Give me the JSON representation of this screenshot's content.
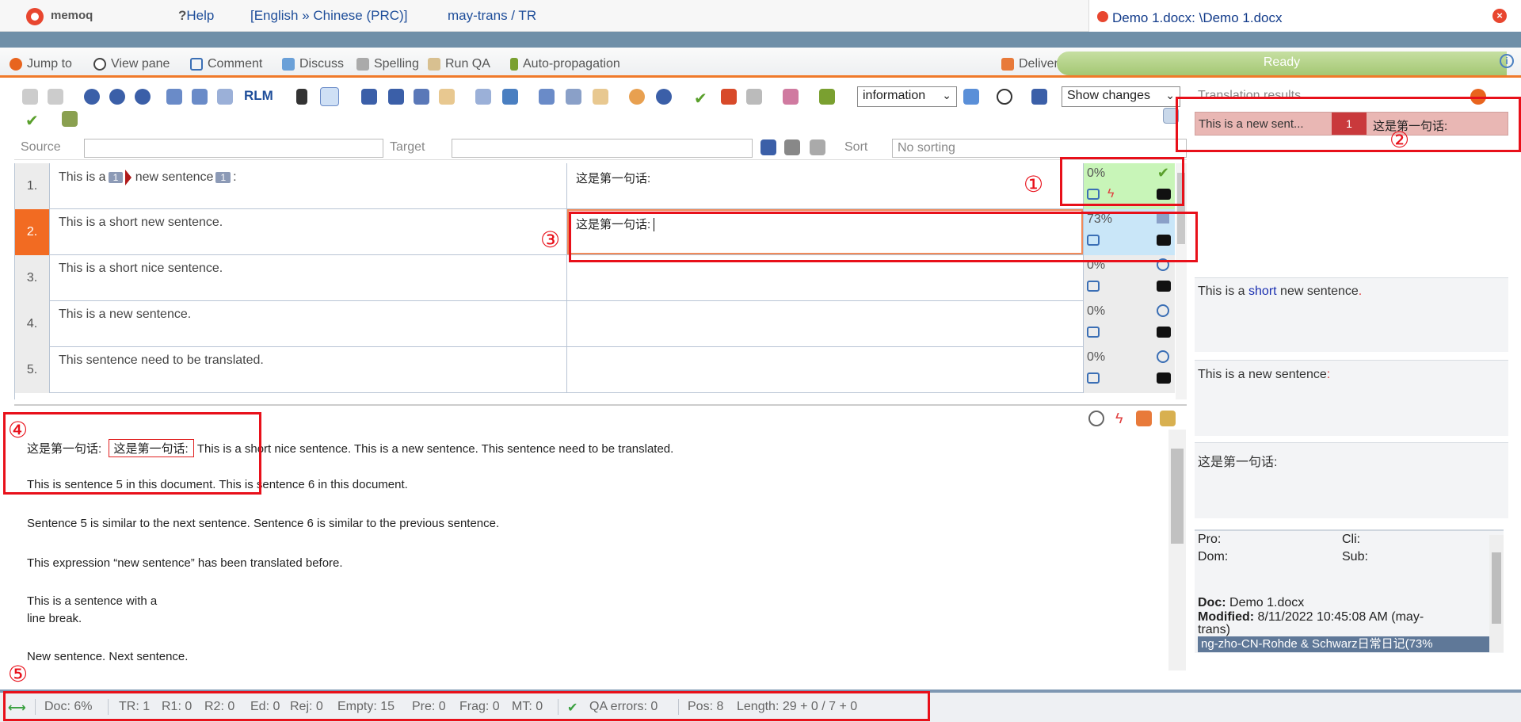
{
  "topbar": {
    "logo": "memoq",
    "help": "Help",
    "language": "[English » Chinese (PRC)]",
    "project": "may-trans / TR",
    "document_tab": "Demo 1.docx: \\Demo 1.docx"
  },
  "ribbon": {
    "items": [
      "Jump to",
      "View pane",
      "Comment",
      "Discuss",
      "Spelling",
      "Run QA",
      "Auto-propagation"
    ],
    "deliver": "Deliver",
    "status": "Ready"
  },
  "toolbar": {
    "rlm": "RLM",
    "information_select": "information",
    "show_changes_select": "Show changes"
  },
  "filter": {
    "source_label": "Source",
    "target_label": "Target",
    "sort_label": "Sort",
    "sort_value": "No sorting"
  },
  "grid": {
    "rows": [
      {
        "num": "1.",
        "source_a": "This is a",
        "source_b": "new sentence",
        "source_c": ":",
        "tag1": "1",
        "tag2": "1",
        "target": "这是第一句话:",
        "percent": "0%"
      },
      {
        "num": "2.",
        "source": "This is a short new sentence.",
        "target": "这是第一句话:",
        "percent": "73%"
      },
      {
        "num": "3.",
        "source": "This is a short nice sentence.",
        "target": "",
        "percent": "0%"
      },
      {
        "num": "4.",
        "source": "This is a new sentence.",
        "target": "",
        "percent": "0%"
      },
      {
        "num": "5.",
        "source": "This sentence need to be translated.",
        "target": "",
        "percent": "0%"
      }
    ]
  },
  "preview": {
    "line1_a": "这是第一句话:",
    "line1_b": "这是第一句话:",
    "line1_c": "This is a short nice sentence. This is a new sentence. This sentence need to be translated.",
    "line2": "This is sentence 5 in this document. This is sentence 6 in this document.",
    "line3": "Sentence 5 is similar to the next sentence. Sentence 6 is similar to the previous sentence.",
    "line4": "This expression “new sentence” has been translated before.",
    "line5a": "This is a sentence with a",
    "line5b": "line break.",
    "line6": "New sentence. Next sentence."
  },
  "translation_results": {
    "title": "Translation results",
    "hit_source": "This is a new sent...",
    "hit_number": "1",
    "hit_target": "这是第一句话:",
    "compare_prefix": "This is a ",
    "compare_highlight": "short",
    "compare_suffix": " new sentence",
    "compare_end": ".",
    "source_match": "This is a new sentence",
    "source_match_end": ":",
    "target_match": "这是第一句话:"
  },
  "meta": {
    "pro": "Pro:",
    "cli": "Cli:",
    "dom": "Dom:",
    "sub": "Sub:",
    "doc_label": "Doc:",
    "doc_value": "Demo 1.docx",
    "modified_label": "Modified:",
    "modified_value": "8/11/2022 10:45:08 AM (may-",
    "modified_value2": "trans)",
    "tm_bar": "ng-zho-CN-Rohde & Schwarz日常日记(73%"
  },
  "statusbar": {
    "doc": "Doc: 6%",
    "tr": "TR: 1",
    "r1": "R1: 0",
    "r2": "R2: 0",
    "ed": "Ed: 0",
    "rej": "Rej: 0",
    "empty": "Empty: 15",
    "pre": "Pre: 0",
    "frag": "Frag: 0",
    "mt": "MT: 0",
    "qa": "QA errors: 0",
    "pos": "Pos: 8",
    "length": "Length: 29 + 0 / 7 + 0"
  },
  "annotations": [
    "①",
    "②",
    "③",
    "④",
    "⑤"
  ],
  "colors": {
    "accent_orange": "#f26b22",
    "annotation_red": "#e8101a",
    "ready_green": "#a4c773",
    "tm_hit": "#e9b7b4",
    "confirmed_green": "#c8f5b8",
    "fuzzy_blue": "#c9e6f8"
  }
}
